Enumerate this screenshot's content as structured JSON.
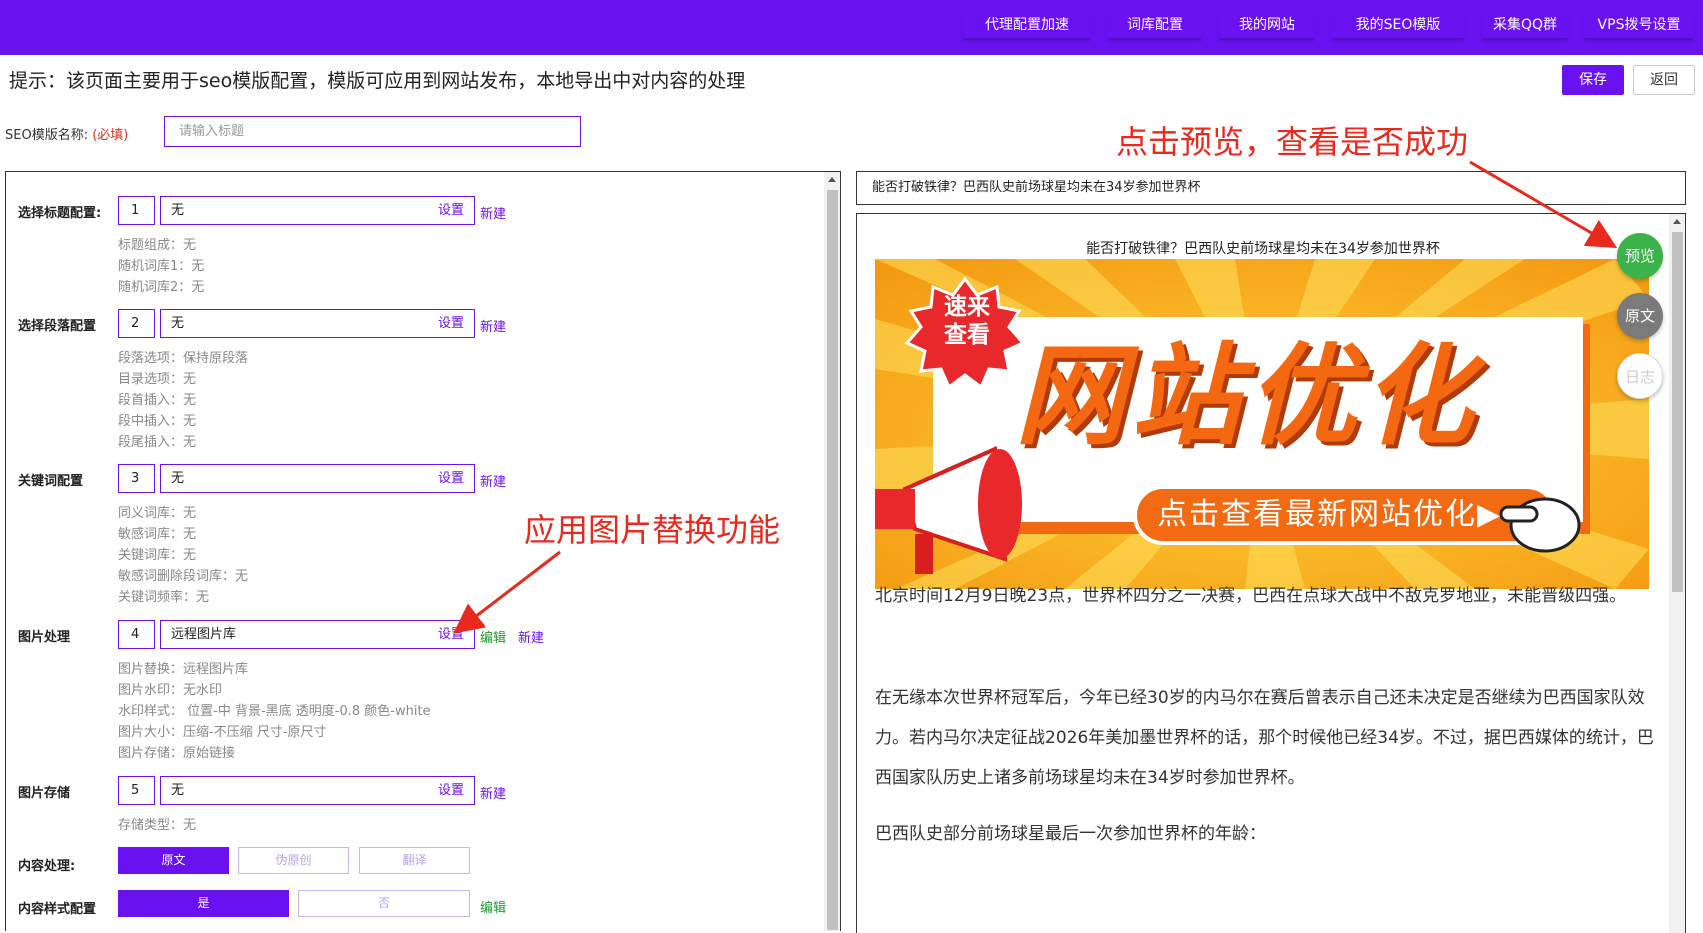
{
  "topnav": {
    "items": [
      "代理配置加速",
      "词库配置",
      "我的网站",
      "我的SEO模版",
      "采集QQ群",
      "VPS拨号设置"
    ],
    "bg_color": "#6a11f2"
  },
  "header": {
    "hint": "提示：该页面主要用于seo模版配置，模版可应用到网站发布，本地导出中对内容的处理",
    "save_label": "保存",
    "back_label": "返回"
  },
  "template_name": {
    "label": "SEO模版名称:",
    "required": "(必填)",
    "placeholder": "请输入标题"
  },
  "config": {
    "title": {
      "label": "选择标题配置:",
      "num": "1",
      "value": "无",
      "set": "设置",
      "new": "新建",
      "details": [
        "标题组成：无",
        "随机词库1：无",
        "随机词库2：无"
      ]
    },
    "paragraph": {
      "label": "选择段落配置",
      "num": "2",
      "value": "无",
      "set": "设置",
      "new": "新建",
      "details": [
        "段落选项：保持原段落",
        "目录选项：无",
        "段首插入：无",
        "段中插入：无",
        "段尾插入：无"
      ]
    },
    "keyword": {
      "label": "关键词配置",
      "num": "3",
      "value": "无",
      "set": "设置",
      "new": "新建",
      "details": [
        "同义词库：无",
        "敏感词库：无",
        "关键词库：无",
        "敏感词删除段词库：无",
        "关键词频率：无"
      ]
    },
    "image": {
      "label": "图片处理",
      "num": "4",
      "value": "远程图片库",
      "set": "设置",
      "edit": "编辑",
      "new": "新建",
      "details": [
        "图片替换：远程图片库",
        "图片水印：无水印",
        "水印样式： 位置-中 背景-黑底 透明度-0.8 颜色-white",
        "图片大小：压缩-不压缩 尺寸-原尺寸",
        "图片存储：原始链接"
      ]
    },
    "storage": {
      "label": "图片存储",
      "num": "5",
      "value": "无",
      "set": "设置",
      "new": "新建",
      "details": [
        "存储类型：无"
      ]
    },
    "content": {
      "label": "内容处理:",
      "options": [
        "原文",
        "伪原创",
        "翻译"
      ],
      "selected": "原文"
    },
    "style": {
      "label": "内容样式配置",
      "options": [
        "是",
        "否"
      ],
      "selected": "是",
      "edit": "编辑"
    }
  },
  "preview": {
    "title_field": "能否打破铁律？巴西队史前场球星均未在34岁参加世界杯",
    "article_title": "能否打破铁律？巴西队史前场球星均未在34岁参加世界杯",
    "banner": {
      "badge_line1": "速来",
      "badge_line2": "查看",
      "headline": "网站优化",
      "cta": "点击查看最新网站优化▶"
    },
    "paragraphs": [
      "北京时间12月9日晚23点，世界杯四分之一决赛，巴西在点球大战中不敌克罗地亚，未能晋级四强。",
      "在无缘本次世界杯冠军后，今年已经30岁的内马尔在赛后曾表示自己还未决定是否继续为巴西国家队效力。若内马尔决定征战2026年美加墨世界杯的话，那个时候他已经34岁。不过，据巴西媒体的统计，巴西国家队历史上诸多前场球星均未在34岁时参加世界杯。",
      "巴西队史部分前场球星最后一次参加世界杯的年龄："
    ],
    "fabs": {
      "preview": "预览",
      "original": "原文",
      "log": "日志"
    }
  },
  "annotations": {
    "preview_hint": "点击预览，查看是否成功",
    "image_hint": "应用图片替换功能"
  }
}
